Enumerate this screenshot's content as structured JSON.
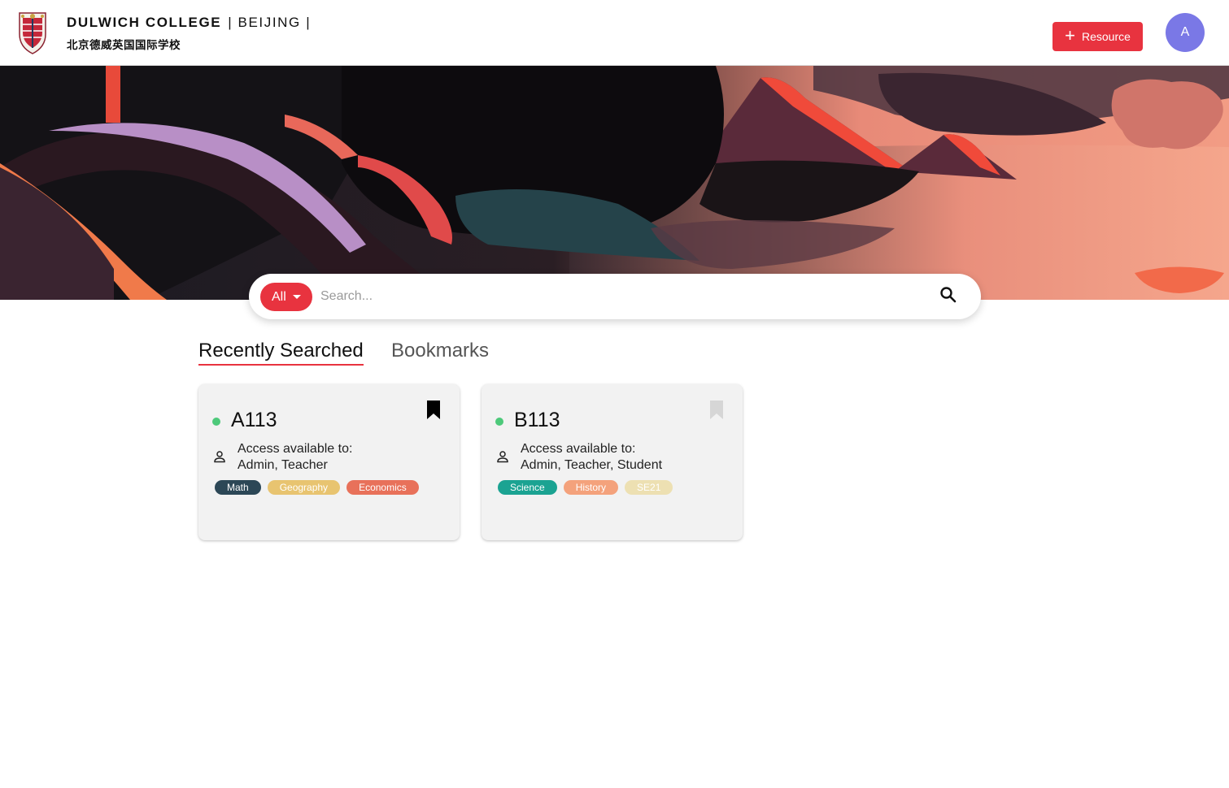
{
  "header": {
    "brand_name": "DULWICH COLLEGE",
    "brand_location": "| BEIJING |",
    "brand_chinese": "北京德威英国国际学校",
    "resource_button_label": "Resource",
    "avatar_initial": "A"
  },
  "search": {
    "filter_label": "All",
    "placeholder": "Search..."
  },
  "tabs": [
    {
      "label": "Recently Searched",
      "active": true
    },
    {
      "label": "Bookmarks",
      "active": false
    }
  ],
  "cards": [
    {
      "title": "A113",
      "access_label": "Access available to:",
      "access_roles": "Admin, Teacher",
      "bookmarked": true,
      "tags": [
        {
          "label": "Math",
          "color": "#2c4756"
        },
        {
          "label": "Geography",
          "color": "#e8c470"
        },
        {
          "label": "Economics",
          "color": "#e8715a"
        }
      ]
    },
    {
      "title": "B113",
      "access_label": "Access available to:",
      "access_roles": "Admin, Teacher, Student",
      "bookmarked": false,
      "tags": [
        {
          "label": "Science",
          "color": "#1ba392"
        },
        {
          "label": "History",
          "color": "#f4a27c"
        },
        {
          "label": "SE21",
          "color": "#ede0b2"
        }
      ]
    }
  ],
  "colors": {
    "accent": "#e8333f",
    "avatar": "#7a78e6",
    "status_active": "#4dc97a"
  }
}
